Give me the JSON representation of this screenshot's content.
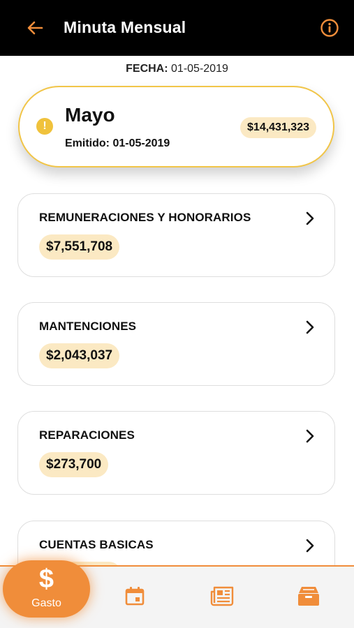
{
  "header": {
    "title": "Minuta Mensual",
    "back_icon": "arrow-left-icon",
    "info_icon": "info-icon"
  },
  "date": {
    "label": "FECHA:",
    "value": "01-05-2019"
  },
  "summary": {
    "month": "Mayo",
    "issued": "Emitido: 01-05-2019",
    "total": "$14,431,323",
    "status_icon": "warning-icon"
  },
  "categories": [
    {
      "name": "REMUNERACIONES Y HONORARIOS",
      "amount": "$7,551,708"
    },
    {
      "name": "MANTENCIONES",
      "amount": "$2,043,037"
    },
    {
      "name": "REPARACIONES",
      "amount": "$273,700"
    },
    {
      "name": "CUENTAS BASICAS",
      "amount": ""
    }
  ],
  "bottom_nav": {
    "primary": {
      "symbol": "$",
      "label": "Gasto"
    },
    "items": [
      "calendar-icon",
      "newspaper-icon",
      "archive-icon"
    ]
  },
  "colors": {
    "accent": "#f08d3a",
    "highlight": "#fbe9c3",
    "summary_border": "#f1c548",
    "header_bg": "#000000"
  }
}
